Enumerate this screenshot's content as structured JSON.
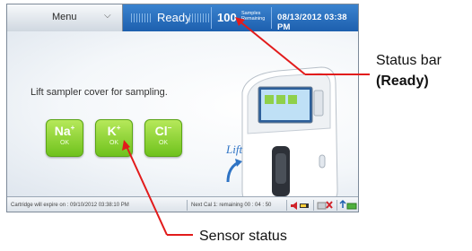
{
  "topbar": {
    "menu_label": "Menu",
    "status_text": "Ready",
    "samples_count": "100",
    "samples_label_line1": "Samples",
    "samples_label_line2": "Remaining",
    "datetime": "08/13/2012 03:38 PM"
  },
  "main": {
    "message": "Lift sampler cover for sampling.",
    "sensors": [
      {
        "ion": "Na",
        "charge": "+",
        "status": "OK"
      },
      {
        "ion": "K",
        "charge": "+",
        "status": "OK"
      },
      {
        "ion": "Cl",
        "charge": "−",
        "status": "OK"
      }
    ],
    "device_lift_label": "Lift"
  },
  "statusbar": {
    "cartridge_expire": "Cartridge will expire on : 09/10/2012 03:38:10 PM",
    "next_cal": "Next Cal 1: remaining 00 : 04 : 50"
  },
  "annotations": {
    "status_bar_line1": "Status bar",
    "status_bar_line2": "(Ready)",
    "sensor_status": "Sensor status"
  },
  "colors": {
    "topbar_blue": "#1d5fae",
    "sensor_green": "#6fc21d",
    "callout_red": "#e21b1b"
  }
}
